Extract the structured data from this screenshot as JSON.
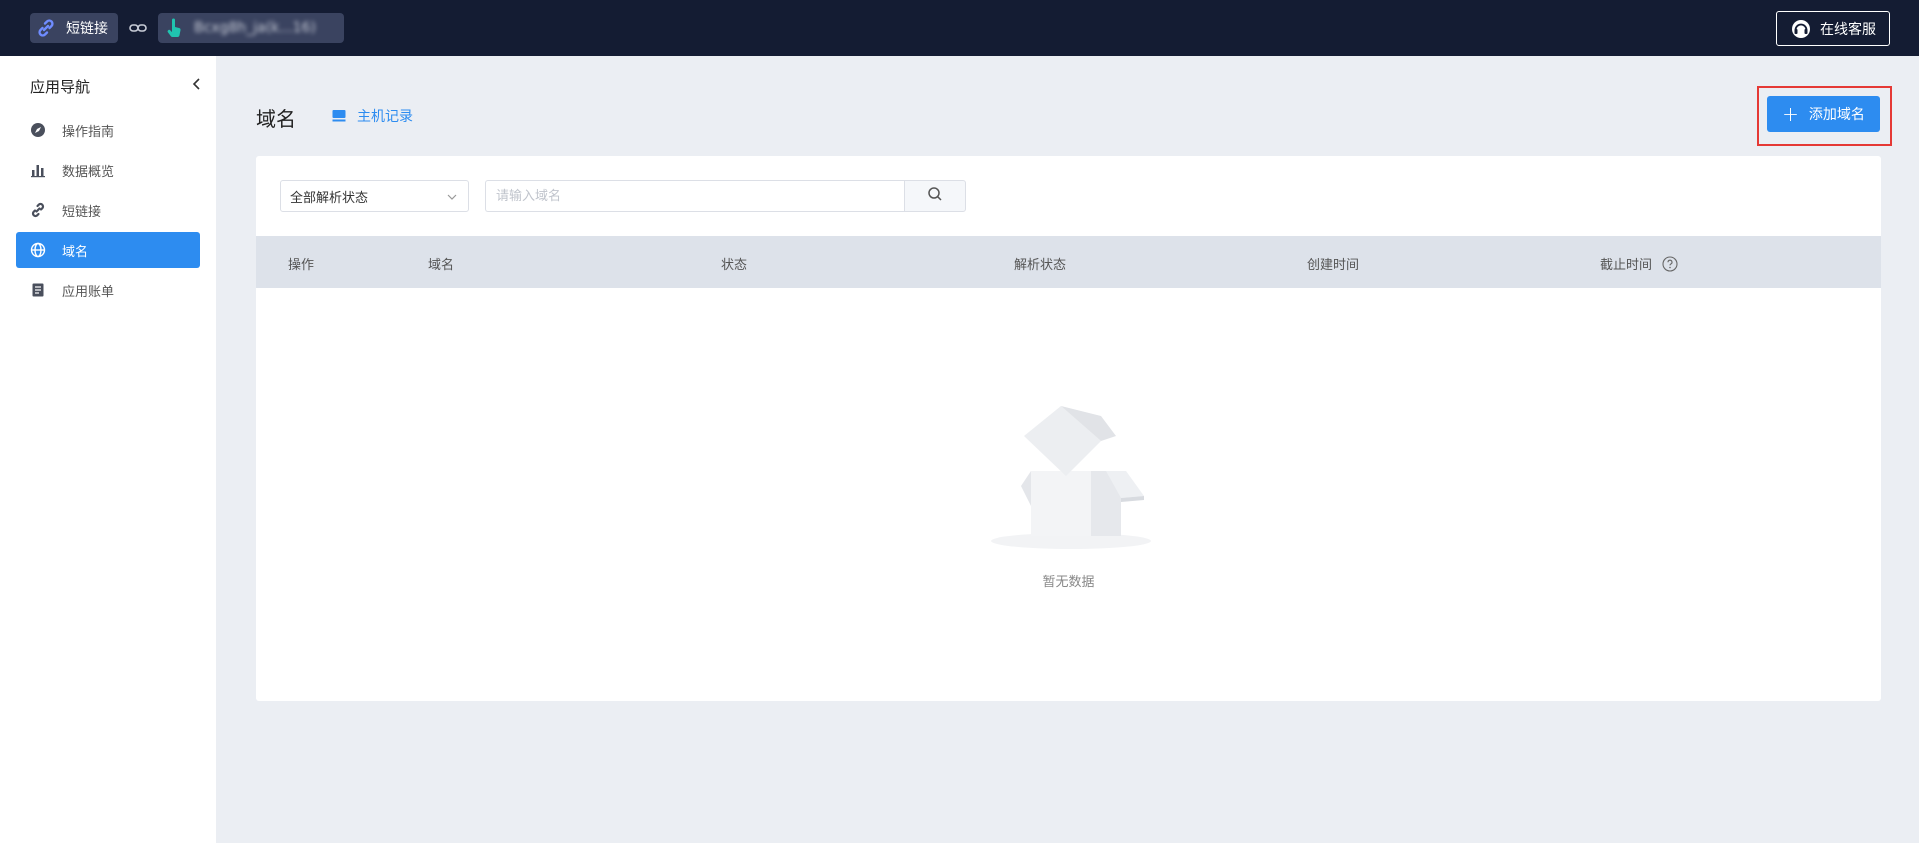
{
  "topbar": {
    "app_name": "短链接",
    "account_text": "Bcxg8h_ja(k...16)",
    "support_label": "在线客服"
  },
  "sidebar": {
    "title": "应用导航",
    "items": [
      {
        "label": "操作指南",
        "icon": "compass-icon",
        "active": false
      },
      {
        "label": "数据概览",
        "icon": "bar-chart-icon",
        "active": false
      },
      {
        "label": "短链接",
        "icon": "link-icon",
        "active": false
      },
      {
        "label": "域名",
        "icon": "globe-icon",
        "active": true
      },
      {
        "label": "应用账单",
        "icon": "document-icon",
        "active": false
      }
    ]
  },
  "main": {
    "title": "域名",
    "host_link": "主机记录",
    "add_button": "添加域名",
    "filter": {
      "status_select": "全部解析状态",
      "search_placeholder": "请输入域名"
    },
    "table": {
      "columns": [
        "操作",
        "域名",
        "状态",
        "解析状态",
        "创建时间",
        "截止时间"
      ],
      "rows": []
    },
    "empty_text": "暂无数据"
  },
  "colors": {
    "topbar_bg": "#141c33",
    "primary": "#2d8cf0",
    "highlight_border": "#e53935",
    "page_bg": "#ebeef3"
  }
}
